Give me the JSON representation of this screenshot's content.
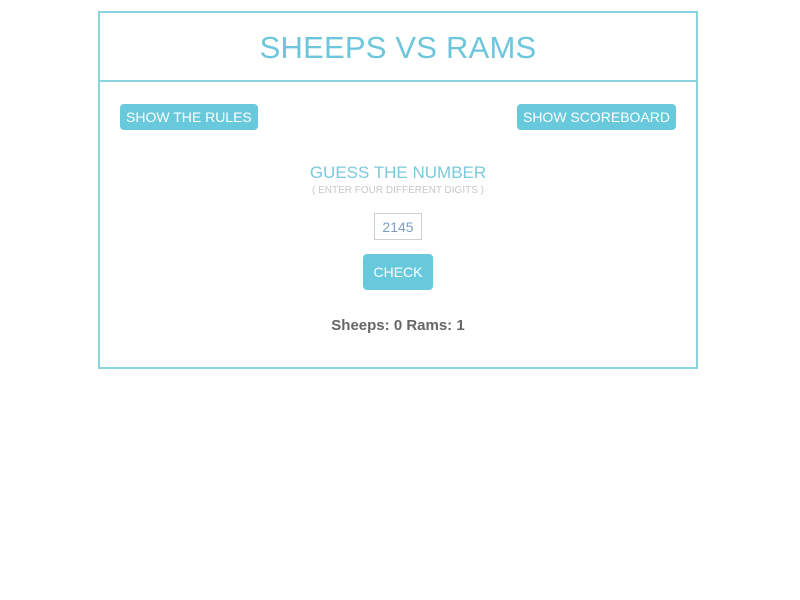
{
  "header": {
    "title": "SHEEPS VS RAMS"
  },
  "toolbar": {
    "rules_label": "SHOW THE RULES",
    "scoreboard_label": "SHOW SCOREBOARD"
  },
  "game": {
    "heading": "GUESS THE NUMBER",
    "hint": "( ENTER FOUR DIFFERENT DIGITS )",
    "guess_value": "2145",
    "check_label": "CHECK",
    "result": {
      "sheeps_label": "Sheeps:",
      "sheeps_count": "0",
      "rams_label": "Rams:",
      "rams_count": "1"
    }
  },
  "colors": {
    "accent": "#69c9dc",
    "border": "#8ad4e0",
    "result_text": "#666666"
  }
}
